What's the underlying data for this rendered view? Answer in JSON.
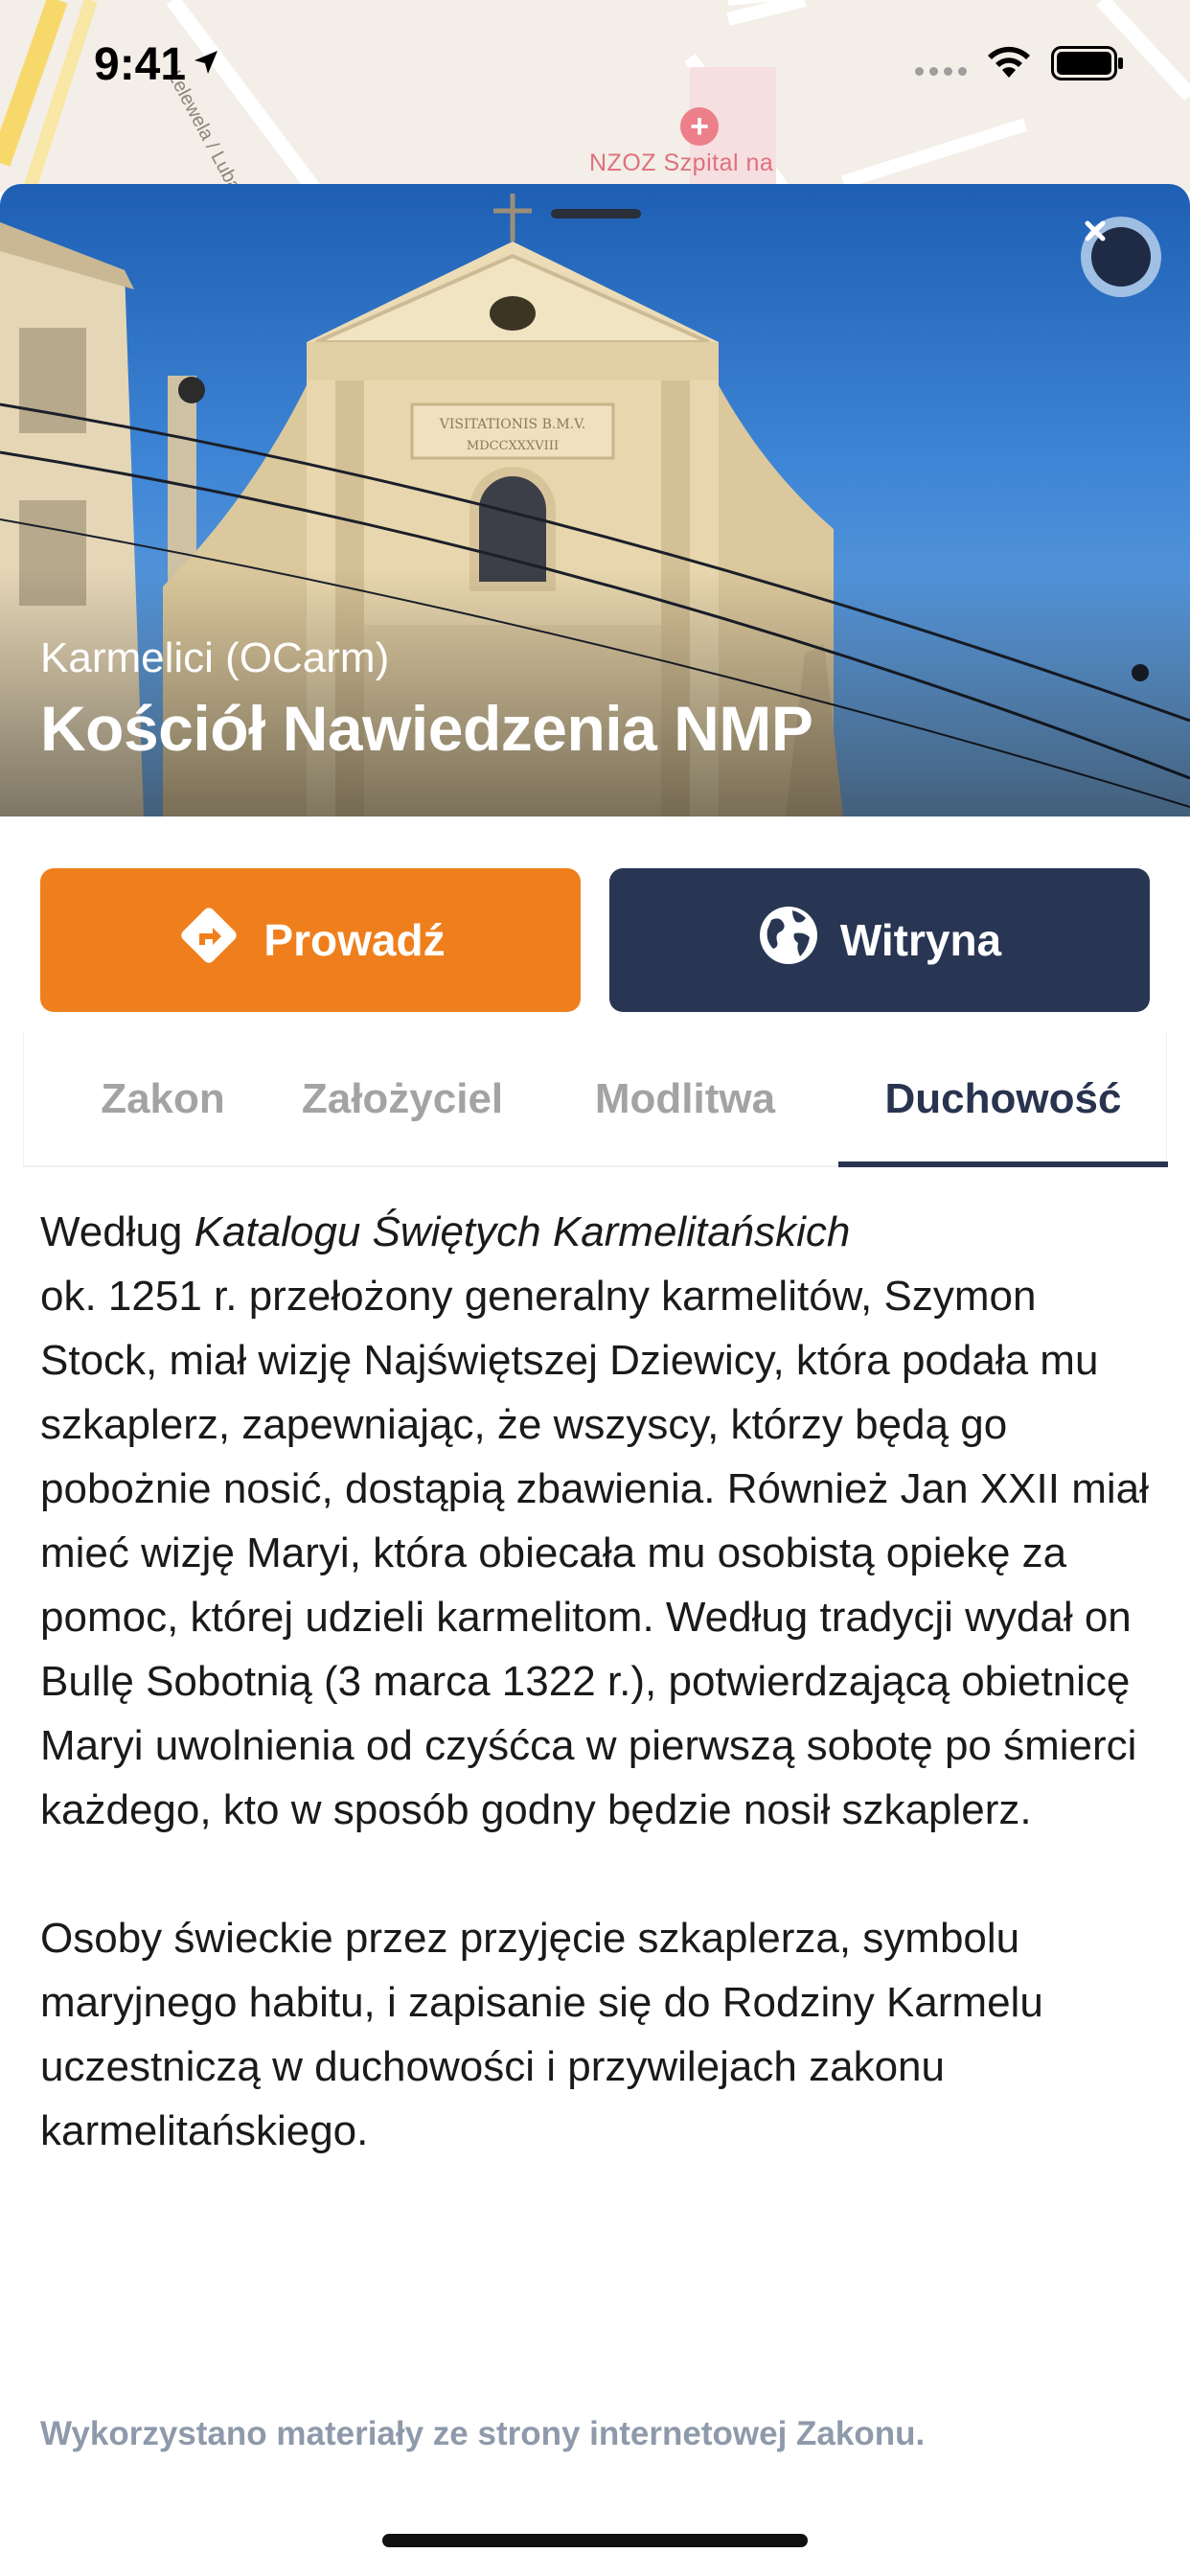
{
  "status_bar": {
    "time": "9:41"
  },
  "map": {
    "street": "Lelewela / Lubartowicza",
    "poi": "NZOZ Szpital na"
  },
  "hero": {
    "subtitle": "Karmelici (OCarm)",
    "title": "Kościół Nawiedzenia NMP",
    "inscription_1": "VISITATIONIS B.M.V.",
    "inscription_2": "MDCCXXXVIII"
  },
  "actions": {
    "navigate_label": "Prowadź",
    "website_label": "Witryna"
  },
  "tabs": [
    {
      "label": "Zakon"
    },
    {
      "label": "Założyciel"
    },
    {
      "label": "Modlitwa"
    },
    {
      "label": "Duchowość",
      "active": true
    }
  ],
  "content": {
    "p1_lead": "Według ",
    "p1_italic": "Katalogu Świętych Karmelitańskich",
    "p1_rest": "ok. 1251 r. przełożony generalny karmelitów, Szymon Stock, miał wizję Najświętszej Dziewicy, która podała mu szkaplerz, zapewniając, że wszyscy, którzy będą go pobożnie nosić, dostąpią zbawienia. Również Jan XXII miał mieć wizję Maryi, która obiecała mu osobistą opiekę za pomoc, której udzieli karmelitom. Według tradycji wydał on Bullę Sobotnią (3 marca 1322 r.), potwierdzającą obietnicę Maryi uwolnienia od czyśćca w pierwszą sobotę po śmierci każdego, kto w sposób godny będzie nosił szkaplerz.",
    "p2": "Osoby świeckie przez przyjęcie szkaplerza, symbolu maryjnego habitu, i zapisanie się do Rodziny Karmelu uczestniczą w duchowości i przywilejach zakonu karmelitańskiego.",
    "source": "Wykorzystano materiały ze strony internetowej Zakonu."
  },
  "colors": {
    "accent_orange": "#ef7f1d",
    "navy": "#283654",
    "tab_inactive": "#a3a3a3",
    "source_text": "#8e9aab"
  },
  "icons": {
    "navigate": "directions-diamond-icon",
    "website": "globe-icon",
    "close": "close-icon",
    "location": "location-arrow-icon",
    "wifi": "wifi-icon",
    "battery": "battery-icon"
  }
}
